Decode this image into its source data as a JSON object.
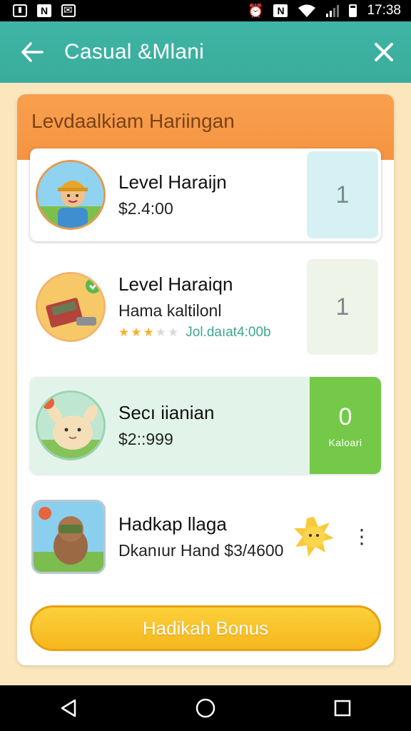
{
  "status_bar": {
    "time": "17:38"
  },
  "app_bar": {
    "title": "Casual &Mlani"
  },
  "card": {
    "header": "Levdaalkiam Hariingan",
    "items": [
      {
        "title": "Level Haraijn",
        "subtitle": "$2.4:00",
        "rank": "1"
      },
      {
        "title": "Level Haraiqn",
        "subtitle": "Hama kaltilonl",
        "rating": 3,
        "meta": "Jol.daıat4:00b",
        "rank": "1"
      },
      {
        "title": "Secı iianian",
        "subtitle": "$2::999",
        "rank": "0",
        "rank_label": "Kaloari"
      },
      {
        "title": "Hadkap llaga",
        "subtitle": "Dkanıur Hand $3/4600"
      }
    ],
    "bonus_button": "Hadikah Bonus"
  },
  "colors": {
    "teal": "#3fb5a5",
    "orange": "#f59441",
    "green": "#74c948",
    "gold": "#f6b71c"
  },
  "icons": [
    "download-icon",
    "n-app-icon",
    "mail-icon",
    "alarm-icon",
    "photo-icon",
    "wifi-icon",
    "signal-icon",
    "battery-icon",
    "back-arrow-icon",
    "close-icon",
    "back-nav-icon",
    "home-nav-icon",
    "recents-nav-icon"
  ]
}
